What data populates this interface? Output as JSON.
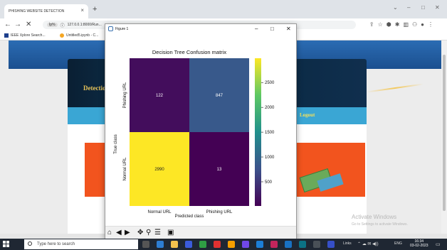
{
  "browser": {
    "tab_title": "PHISHING WEBSITE DETECTION",
    "tab_close": "×",
    "new_tab": "+",
    "url_chip": "ṫp%",
    "url": "127.0.0.1:8000/Run...",
    "bookmarks": [
      "IEEE Xplore Search...",
      "Untitled5.ipynb - C..."
    ],
    "window_controls": [
      "⌄",
      "–",
      "□",
      "✕"
    ]
  },
  "webpage": {
    "banner_title": "Detectio",
    "logout": "Logout",
    "watermark_title": "Activate Windows",
    "watermark_sub": "Go to Settings to activate Windows."
  },
  "figure_window": {
    "title": "Figure 1",
    "controls": [
      "–",
      "□",
      "✕"
    ],
    "toolbar_icons": [
      "home-icon",
      "back-arrow-icon",
      "forward-arrow-icon",
      "pan-icon",
      "zoom-icon",
      "configure-subplots-icon",
      "save-icon"
    ]
  },
  "chart_data": {
    "type": "heatmap",
    "title": "Decision Tree Confusion matrix",
    "xlabel": "Predicted class",
    "ylabel": "True class",
    "x_categories": [
      "Normal URL",
      "Phishing URL"
    ],
    "y_categories": [
      "Phishing URL",
      "Normal URL"
    ],
    "values": [
      [
        122,
        847
      ],
      [
        2990,
        13
      ]
    ],
    "colorbar_ticks": [
      500,
      1000,
      1500,
      2000,
      2500
    ],
    "colorbar_range": [
      13,
      2990
    ],
    "colormap": "viridis"
  },
  "taskbar": {
    "search_placeholder": "Type here to search",
    "tray_label": "Links",
    "tray_lang": "ENG",
    "time": "16:34",
    "date": "03-02-2023"
  },
  "colors": {
    "banner_accent": "#e8c45a",
    "menu_bar": "#3aa6d4",
    "orange_tile": "#f2541e",
    "taskbar": "#1f2733"
  }
}
